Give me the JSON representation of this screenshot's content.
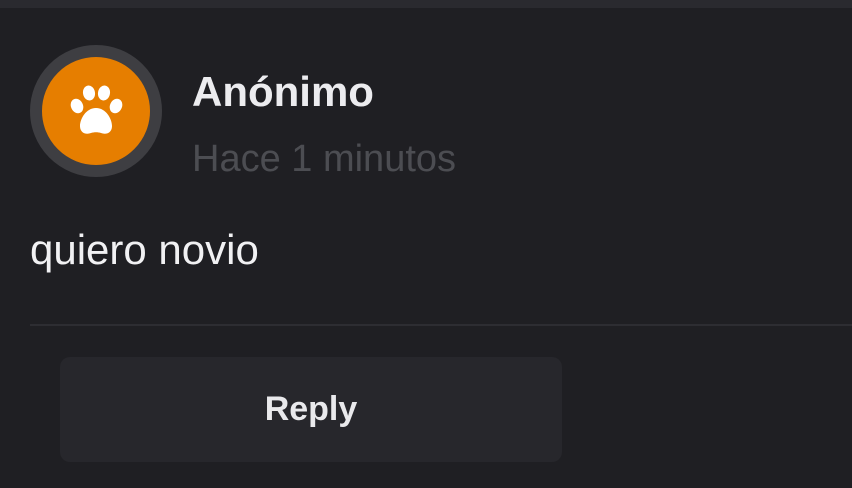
{
  "comment": {
    "author": "Anónimo",
    "time": "Hace 1 minutos",
    "text": "quiero novio",
    "avatar_icon": "paw-icon",
    "avatar_color": "#e67e00"
  },
  "actions": {
    "reply_label": "Reply"
  }
}
